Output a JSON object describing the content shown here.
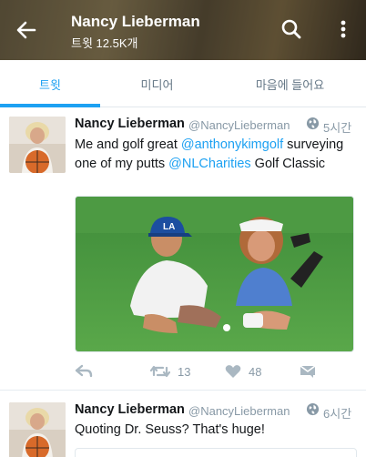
{
  "header": {
    "title": "Nancy Lieberman",
    "subtitle": "트윗 12.5K개",
    "back_icon": "arrow-left-icon",
    "search_icon": "search-icon",
    "more_icon": "more-vertical-icon"
  },
  "tabs": [
    {
      "label": "트윗",
      "active": true
    },
    {
      "label": "미디어",
      "active": false
    },
    {
      "label": "마음에 들어요",
      "active": false
    }
  ],
  "tweets": [
    {
      "name": "Nancy Lieberman",
      "handle": "@NancyLieberman",
      "time": "5시간",
      "text_parts": [
        "Me and golf great ",
        "@anthonykimgolf",
        " surveying one of my putts ",
        "@NLCharities",
        " Golf Classic"
      ],
      "replies_icon": "reply-icon",
      "retweets": "13",
      "likes": "48",
      "dm_icon": "direct-message-icon"
    },
    {
      "name": "Nancy Lieberman",
      "handle": "@NancyLieberman",
      "time": "6시간",
      "text": "Quoting Dr. Seuss? That's huge!"
    }
  ],
  "colors": {
    "accent": "#1da1f2",
    "text": "#14171a",
    "muted": "#8899a6"
  }
}
